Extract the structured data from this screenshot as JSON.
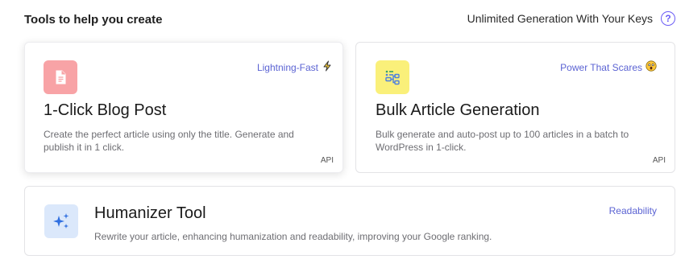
{
  "header": {
    "title": "Tools to help you create",
    "right_text": "Unlimited Generation With Your Keys",
    "help_icon": "?"
  },
  "cards": [
    {
      "title": "1-Click Blog Post",
      "tag": "Lightning-Fast",
      "tag_icon": "lightning-icon",
      "description": "Create the perfect article using only the title. Generate and publish it in 1 click.",
      "badge": "API",
      "icon": "document-icon",
      "icon_bg": "#f8a3a6"
    },
    {
      "title": "Bulk Article Generation",
      "tag": "Power That Scares",
      "tag_icon": "scared-face-icon",
      "description": "Bulk generate and auto-post up to 100 articles in a batch to WordPress in 1-click.",
      "badge": "API",
      "icon": "flowchart-icon",
      "icon_bg": "#faf07a"
    },
    {
      "title": "Humanizer Tool",
      "tag": "Readability",
      "description": "Rewrite your article, enhancing humanization and readability, improving your Google ranking.",
      "icon": "sparkles-icon",
      "icon_bg": "#dbe8fb"
    }
  ],
  "colors": {
    "accent": "#5b63d3",
    "help_icon": "#6b5cf6"
  }
}
